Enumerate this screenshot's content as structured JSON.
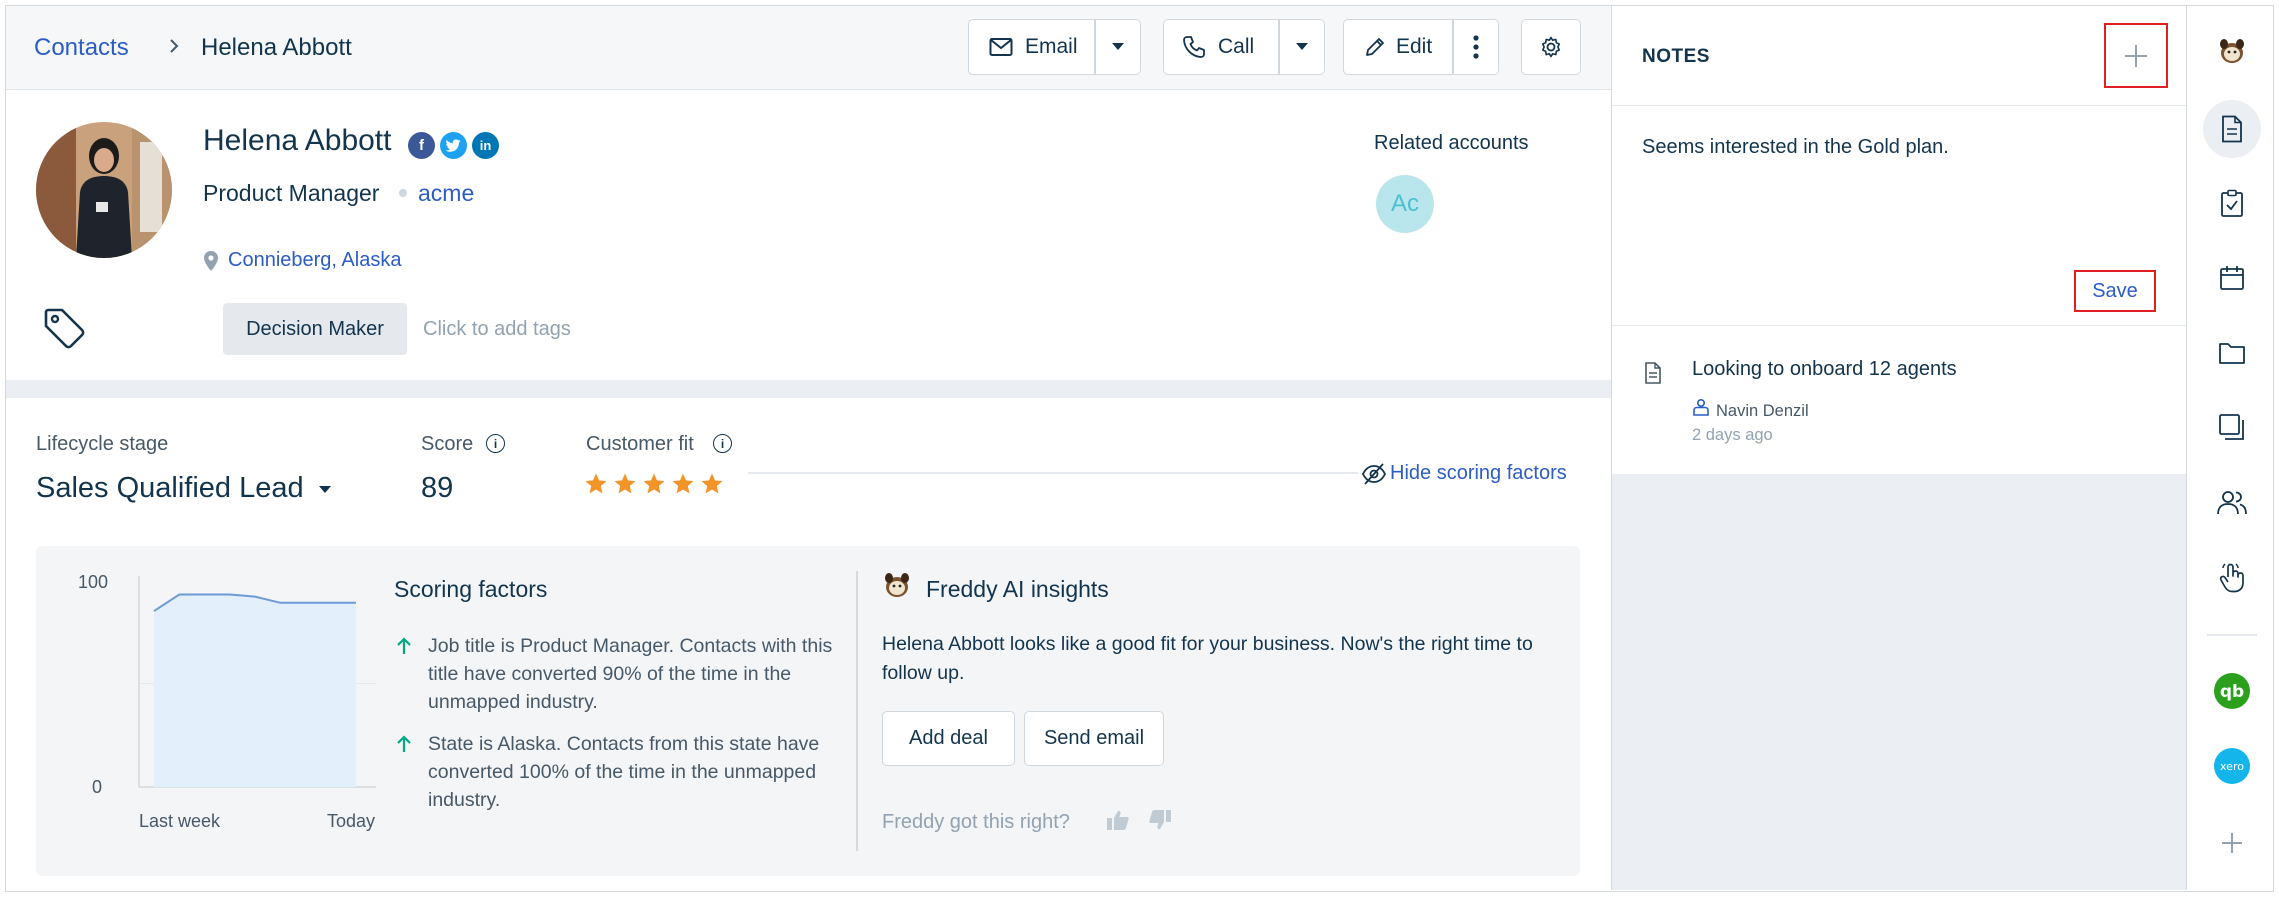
{
  "breadcrumb": {
    "root": "Contacts",
    "current": "Helena Abbott"
  },
  "toolbar": {
    "email_label": "Email",
    "call_label": "Call",
    "edit_label": "Edit"
  },
  "contact": {
    "name": "Helena Abbott",
    "title": "Product Manager",
    "company": "acme",
    "location": "Connieberg, Alaska",
    "social": [
      "facebook",
      "twitter",
      "linkedin"
    ],
    "social_colors": {
      "facebook": "#3b5998",
      "twitter": "#1da1f2",
      "linkedin": "#0077b5"
    },
    "tags": [
      "Decision Maker"
    ],
    "tag_placeholder": "Click to add tags"
  },
  "related": {
    "title": "Related accounts",
    "avatar_initials": "Ac"
  },
  "metrics": {
    "lifecycle_label": "Lifecycle stage",
    "lifecycle_value": "Sales Qualified Lead",
    "score_label": "Score",
    "score_value": "89",
    "fit_label": "Customer fit",
    "fit_stars": 5,
    "hide_scoring": "Hide scoring factors"
  },
  "chart_data": {
    "type": "area",
    "x": [
      "Last week",
      "Today"
    ],
    "xlabel": "",
    "ylabel": "",
    "ylim": [
      0,
      100
    ],
    "ytick_labels": [
      "100",
      "0"
    ],
    "series": [
      {
        "values": [
          85,
          93,
          93,
          93,
          92,
          89,
          89,
          89,
          89
        ]
      }
    ]
  },
  "scoring": {
    "title": "Scoring factors",
    "items": [
      "Job title is Product Manager. Contacts with this title have converted 90% of the time in the unmapped industry.",
      "State is Alaska. Contacts from this state have converted 100% of the time in the unmapped industry."
    ]
  },
  "freddy": {
    "title": "Freddy AI insights",
    "text": "Helena Abbott looks like a good fit for your business. Now's the right time to follow up.",
    "add_deal": "Add deal",
    "send_email": "Send email",
    "feedback": "Freddy got this right?"
  },
  "notes": {
    "title": "NOTES",
    "draft": "Seems interested in the Gold plan.",
    "save_label": "Save",
    "items": [
      {
        "title": "Looking to onboard 12 agents",
        "author": "Navin Denzil",
        "time": "2 days ago"
      }
    ]
  },
  "rail": {
    "icons": [
      "freddy-icon",
      "notes-icon",
      "tasks-icon",
      "calendar-icon",
      "files-icon",
      "copy-icon",
      "contacts-icon",
      "touch-icon",
      "quickbooks-icon",
      "xero-icon",
      "add-icon"
    ],
    "colors": {
      "quickbooks": "#2ca01c",
      "xero": "#13b5ea"
    }
  },
  "colors": {
    "accent": "#2c5cc5",
    "star": "#f29427",
    "highlight": "#e02020"
  }
}
